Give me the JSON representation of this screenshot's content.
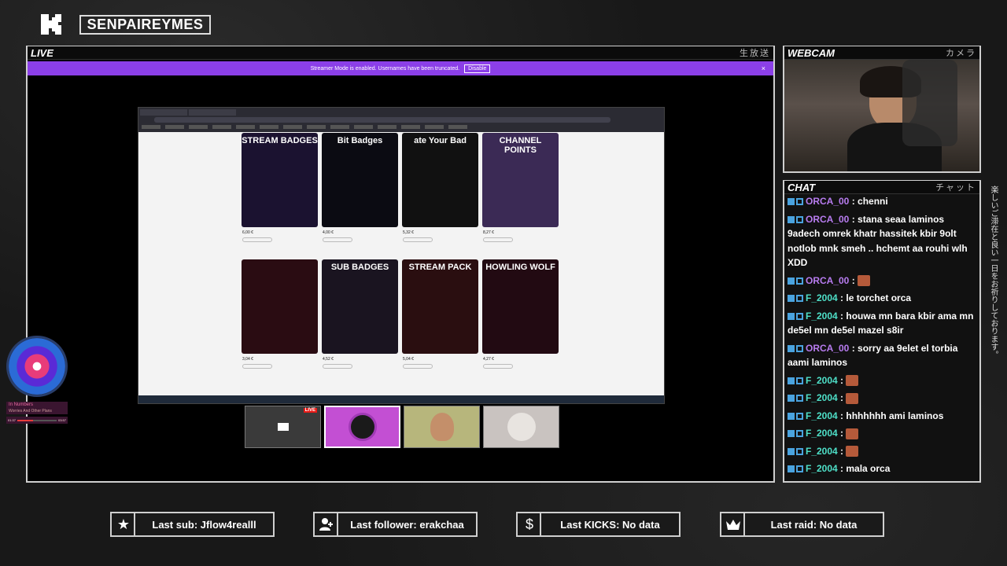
{
  "header": {
    "channel_name": "SENPAIREYMES"
  },
  "live_panel": {
    "title": "LIVE",
    "jp": "生放送"
  },
  "streamer_mode": {
    "message": "Streamer Mode is enabled. Usernames have been truncated.",
    "button": "Disable",
    "close": "×"
  },
  "shared_screen": {
    "cards": [
      {
        "title": "STREAM BADGES",
        "bg": "#1b1230",
        "price": "6,00 €"
      },
      {
        "title": "Bit Badges",
        "bg": "#0b0b12",
        "price": "4,00 €"
      },
      {
        "title": "ate Your Bad",
        "bg": "#111",
        "price": "5,32 €"
      },
      {
        "title": "CHANNEL POINTS",
        "bg": "#3b2a55",
        "price": "8,27 €"
      },
      {
        "title": "",
        "bg": "#2a0c12",
        "price": "3,04 €"
      },
      {
        "title": "SUB BADGES",
        "bg": "#1a1420",
        "price": "4,52 €"
      },
      {
        "title": "STREAM PACK",
        "bg": "#2a0e10",
        "price": "5,04 €"
      },
      {
        "title": "HOWLING WOLF",
        "bg": "#220a12",
        "price": "4,27 €"
      }
    ]
  },
  "participants": {
    "live_tag": "LIVE"
  },
  "music": {
    "title": "In Numbers",
    "artist": "Worries And Other Plans",
    "elapsed": "01:37",
    "total": "03:57",
    "progress": 0.4
  },
  "webcam": {
    "title": "WEBCAM",
    "jp": "カメラ"
  },
  "chat": {
    "title": "CHAT",
    "jp": "チャット",
    "messages": [
      {
        "user": "ORCA_00",
        "color": "#b87cf0",
        "text": " : chenni"
      },
      {
        "user": "ORCA_00",
        "color": "#b87cf0",
        "text": " : stana seaa laminos 9adech omrek khatr hassitek kbir 9olt notlob mnk smeh .. hchemt aa rouhi wlh XDD"
      },
      {
        "user": "ORCA_00",
        "color": "#b87cf0",
        "text": " : "
      },
      {
        "user": "F_2004",
        "color": "#4ee0c8",
        "text": " : le torchet orca"
      },
      {
        "user": "F_2004",
        "color": "#4ee0c8",
        "text": " : houwa mn bara kbir ama mn de5el mn de5el mazel s8ir"
      },
      {
        "user": "ORCA_00",
        "color": "#b87cf0",
        "text": " : sorry aa 9elet el torbia aami laminos"
      },
      {
        "user": "F_2004",
        "color": "#4ee0c8",
        "text": " : "
      },
      {
        "user": "F_2004",
        "color": "#4ee0c8",
        "text": " : "
      },
      {
        "user": "F_2004",
        "color": "#4ee0c8",
        "text": " : hhhhhhh ami laminos"
      },
      {
        "user": "F_2004",
        "color": "#4ee0c8",
        "text": " : "
      },
      {
        "user": "F_2004",
        "color": "#4ee0c8",
        "text": " : "
      },
      {
        "user": "F_2004",
        "color": "#4ee0c8",
        "text": " : mala orca"
      }
    ]
  },
  "side_text": "楽しいご滞在と良い一日をお祈りしております。",
  "stats": {
    "last_sub": "Last sub: Jflow4realll",
    "last_follower": "Last follower: erakchaa",
    "last_kicks": "Last KICKS: No data",
    "last_raid": "Last raid: No data"
  }
}
